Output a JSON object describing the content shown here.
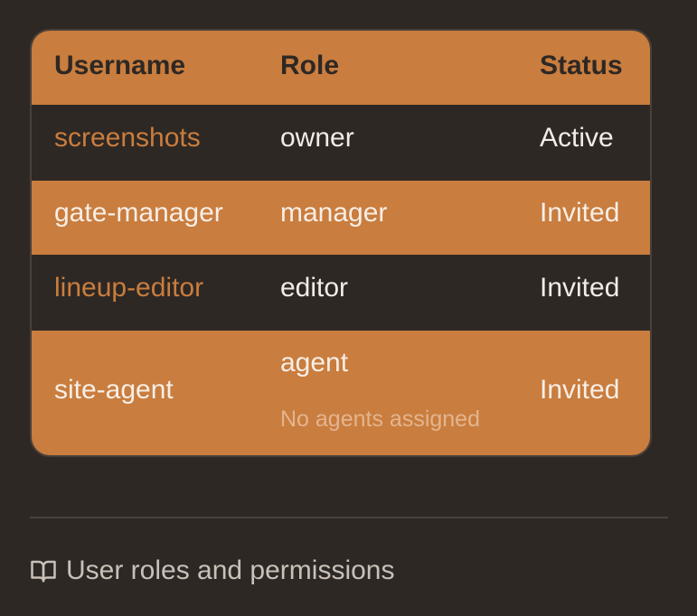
{
  "table": {
    "headers": [
      "Username",
      "Role",
      "Status"
    ],
    "rows": [
      {
        "username": "screenshots",
        "role": "owner",
        "status": "Active"
      },
      {
        "username": "gate-manager",
        "role": "manager",
        "status": "Invited"
      },
      {
        "username": "lineup-editor",
        "role": "editor",
        "status": "Invited"
      },
      {
        "username": "site-agent",
        "role": "agent",
        "role_note": "No agents assigned",
        "status": "Invited"
      }
    ]
  },
  "footer": {
    "help_link_label": "User roles and permissions",
    "help_icon": "book-icon"
  },
  "colors": {
    "background": "#2e2824",
    "accent": "#c97d3e",
    "text_light": "#f1ece8",
    "muted": "#c9c0b8"
  }
}
